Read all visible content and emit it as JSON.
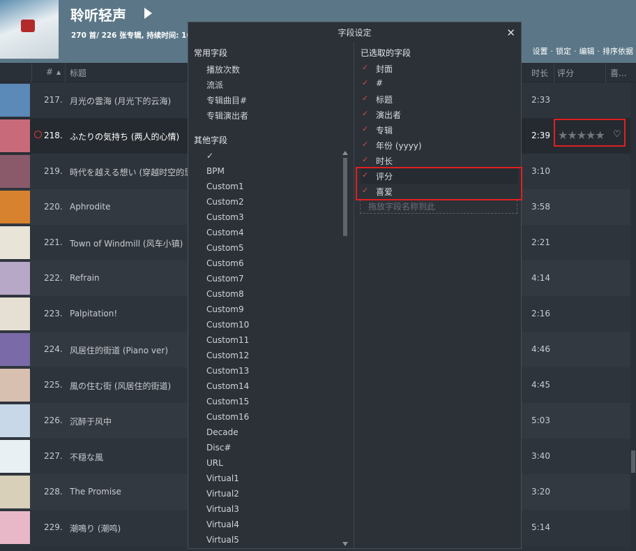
{
  "header": {
    "title": "聆听轻声",
    "subtitle": "270 首/ 226 张专辑, 持续时间: 16:",
    "toolbar": [
      "设置",
      "锁定",
      "编辑",
      "排序依据"
    ]
  },
  "columns": {
    "num": "#",
    "title": "标题",
    "duration": "时长",
    "rating": "评分",
    "love": "喜..."
  },
  "tracks": [
    {
      "num": "217.",
      "title": "月光の雲海 (月光下的云海)",
      "duration": "2:33",
      "art": "#5b89b8"
    },
    {
      "num": "218.",
      "title": "ふたりの気持ち (两人的心情)",
      "duration": "2:39",
      "art": "#c86a7a",
      "playing": true
    },
    {
      "num": "219.",
      "title": "時代を越える想い (穿越时空的思",
      "duration": "3:10",
      "art": "#8a5a6a"
    },
    {
      "num": "220.",
      "title": "Aphrodite",
      "duration": "3:58",
      "art": "#d7822e"
    },
    {
      "num": "221.",
      "title": "Town of Windmill (风车小镇)",
      "duration": "2:21",
      "art": "#e8e4d8"
    },
    {
      "num": "222.",
      "title": "Refrain",
      "duration": "4:14",
      "art": "#b8a8c8"
    },
    {
      "num": "223.",
      "title": "Palpitation!",
      "duration": "2:16",
      "art": "#e6e0d4"
    },
    {
      "num": "224.",
      "title": "风居住的街道 (Piano ver)",
      "duration": "4:46",
      "art": "#7a6aa8"
    },
    {
      "num": "225.",
      "title": "風の住む街 (风居住的街道)",
      "duration": "4:45",
      "art": "#d8c0b0"
    },
    {
      "num": "226.",
      "title": "沉醉于风中",
      "duration": "5:03",
      "art": "#c8d8e8"
    },
    {
      "num": "227.",
      "title": "不穏な風",
      "duration": "3:40",
      "art": "#e8f0f4"
    },
    {
      "num": "228.",
      "title": "The Promise",
      "duration": "3:20",
      "art": "#d8d0b8"
    },
    {
      "num": "229.",
      "title": "潮鳴り (潮鸣)",
      "duration": "5:14",
      "art": "#e8b8c8"
    }
  ],
  "rating": {
    "stars": "★★★★★",
    "heart": "♡"
  },
  "dialog": {
    "title": "字段设定",
    "close": "✕",
    "common_title": "常用字段",
    "common": [
      "播放次数",
      "流派",
      "专辑曲目#",
      "专辑演出者"
    ],
    "other_title": "其他字段",
    "other": [
      "✓",
      "BPM",
      "Custom1",
      "Custom2",
      "Custom3",
      "Custom4",
      "Custom5",
      "Custom6",
      "Custom7",
      "Custom8",
      "Custom9",
      "Custom10",
      "Custom11",
      "Custom12",
      "Custom13",
      "Custom14",
      "Custom15",
      "Custom16",
      "Decade",
      "Disc#",
      "URL",
      "Virtual1",
      "Virtual2",
      "Virtual3",
      "Virtual4",
      "Virtual5"
    ],
    "selected_title": "已选取的字段",
    "selected": [
      "封面",
      "#",
      "标题",
      "演出者",
      "专辑",
      "年份 (yyyy)",
      "时长",
      "评分",
      "喜爱"
    ],
    "drop_hint": "拖放字段名称到此"
  }
}
